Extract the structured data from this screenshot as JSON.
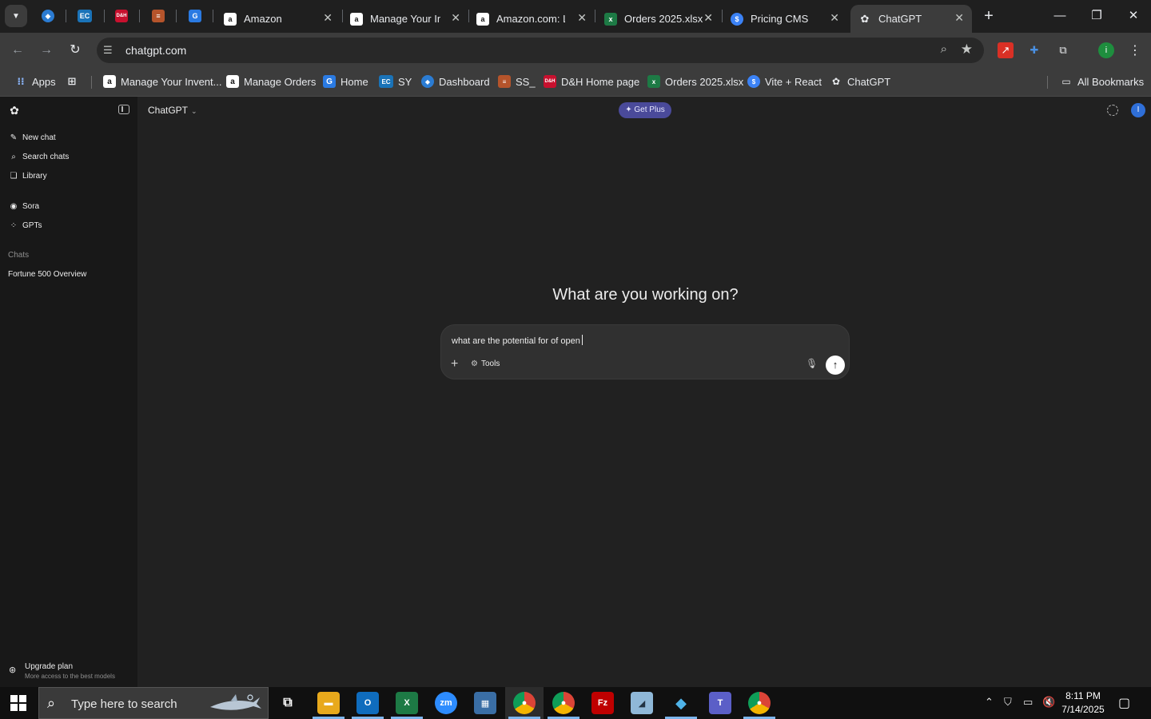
{
  "browser": {
    "tabs": [
      {
        "label": "Amazon"
      },
      {
        "label": "Manage Your Inventory"
      },
      {
        "label": "Amazon.com: LG"
      },
      {
        "label": "Orders 2025.xlsx"
      },
      {
        "label": "Pricing CMS"
      },
      {
        "label": "ChatGPT",
        "active": true
      }
    ],
    "pinned_tabs": [
      {
        "icon": "pinned-app-icon"
      },
      {
        "icon": "ec-icon",
        "glyph": "EC"
      },
      {
        "icon": "dh-icon",
        "glyph": "D&H"
      },
      {
        "icon": "stack-icon"
      },
      {
        "icon": "g-icon",
        "glyph": "G"
      }
    ],
    "url": "chatgpt.com",
    "bookmarks": [
      {
        "label": "Apps"
      },
      {
        "label": "Manage Your Invent..."
      },
      {
        "label": "Manage Orders"
      },
      {
        "label": "Home"
      },
      {
        "label": "SY"
      },
      {
        "label": "Dashboard"
      },
      {
        "label": "SS_"
      },
      {
        "label": "D&H Home page"
      },
      {
        "label": "Orders 2025.xlsx"
      },
      {
        "label": "Vite + React"
      },
      {
        "label": "ChatGPT"
      }
    ],
    "all_bookmarks": "All Bookmarks",
    "colors": {
      "tabstrip": "#1f1f1f",
      "toolbar": "#3c3c3c"
    }
  },
  "sidebar": {
    "items": [
      {
        "label": "New chat",
        "icon": "edit-icon"
      },
      {
        "label": "Search chats",
        "icon": "search-icon"
      },
      {
        "label": "Library",
        "icon": "library-icon"
      },
      {
        "label": "Sora",
        "icon": "sora-icon"
      },
      {
        "label": "GPTs",
        "icon": "gpts-icon"
      }
    ],
    "chats_heading": "Chats",
    "chats": [
      "Fortune 500 Overview"
    ],
    "upgrade": {
      "title": "Upgrade plan",
      "subtitle": "More access to the best models"
    }
  },
  "main": {
    "model": "ChatGPT",
    "get_plus": "Get Plus",
    "avatar_initial": "I",
    "hero": "What are you working on?",
    "composer_text": "what are the potential for of open",
    "tools_label": "Tools",
    "accent": "#4a4a9a"
  },
  "taskbar": {
    "search_placeholder": "Type here to search",
    "time": "8:11 PM",
    "date": "7/14/2025"
  }
}
